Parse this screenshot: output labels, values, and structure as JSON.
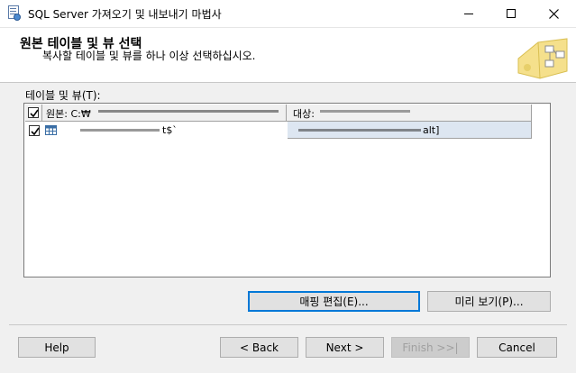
{
  "window": {
    "title": "SQL Server 가져오기 및 내보내기 마법사"
  },
  "header": {
    "title": "원본 테이블 및 뷰 선택",
    "subtitle": "복사할 테이블 및 뷰를 하나 이상 선택하십시오."
  },
  "list": {
    "label": "테이블 및 뷰(T):",
    "columns": {
      "source": "원본: C:₩",
      "destination": "대상: "
    },
    "rows": [
      {
        "checked": true,
        "source": "t$`",
        "destination": "alt]"
      }
    ]
  },
  "buttons": {
    "edit_mappings": "매핑 편집(E)...",
    "preview": "미리 보기(P)...",
    "help": "Help",
    "back": "< Back",
    "next": "Next >",
    "finish": "Finish >>|",
    "cancel": "Cancel"
  },
  "colors": {
    "accent_focus": "#0078d7",
    "selection": "#dde6f1",
    "logo_yellow": "#f5e08c"
  }
}
